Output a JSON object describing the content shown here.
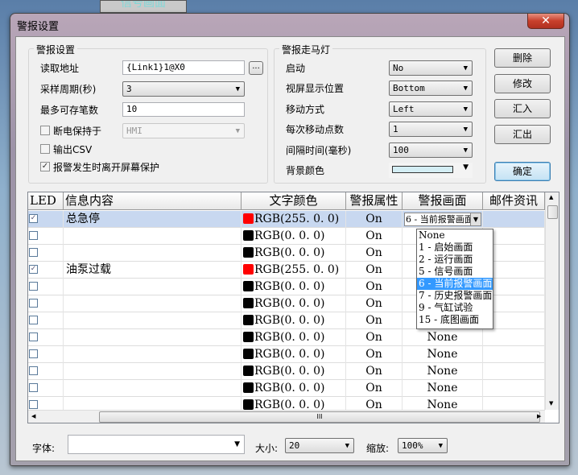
{
  "background": {
    "tab_label": "信号画面"
  },
  "window": {
    "title": "警报设置",
    "close_icon": "close-icon"
  },
  "alarm_settings": {
    "group_label": "警报设置",
    "read_address_label": "读取地址",
    "read_address_value": "{Link1}1@X0",
    "browse_label": "...",
    "sample_period_label": "采样周期(秒)",
    "sample_period_value": "3",
    "max_records_label": "最多可存笔数",
    "max_records_value": "10",
    "power_off_label": "断电保持于",
    "power_off_checked": false,
    "power_off_value": "HMI",
    "export_csv_label": "输出CSV",
    "export_csv_checked": false,
    "leave_screensaver_label": "报警发生时离开屏幕保护",
    "leave_screensaver_checked": true
  },
  "marquee": {
    "group_label": "警报走马灯",
    "enable_label": "启动",
    "enable_value": "No",
    "position_label": "视屏显示位置",
    "position_value": "Bottom",
    "move_label": "移动方式",
    "move_value": "Left",
    "step_label": "每次移动点数",
    "step_value": "1",
    "interval_label": "间隔时间(毫秒)",
    "interval_value": "100",
    "bgcolor_label": "背景颜色",
    "bgcolor_value": "#d4eef4"
  },
  "buttons": {
    "delete": "删除",
    "modify": "修改",
    "import": "汇入",
    "export": "汇出",
    "ok": "确定"
  },
  "table": {
    "columns": [
      "LED",
      "信息内容",
      "文字颜色",
      "警报属性",
      "警报画面",
      "邮件资讯"
    ],
    "rows": [
      {
        "led": true,
        "message": "总急停",
        "color": "#ff0000",
        "color_text": "RGB(255. 0. 0)",
        "attr": "On",
        "screen": "6 - 当前报警画面"
      },
      {
        "led": false,
        "message": "",
        "color": "#000000",
        "color_text": "RGB(0. 0. 0)",
        "attr": "On",
        "screen": "None"
      },
      {
        "led": false,
        "message": "",
        "color": "#000000",
        "color_text": "RGB(0. 0. 0)",
        "attr": "On",
        "screen": "None"
      },
      {
        "led": true,
        "message": "油泵过载",
        "color": "#ff0000",
        "color_text": "RGB(255. 0. 0)",
        "attr": "On",
        "screen": "None"
      },
      {
        "led": false,
        "message": "",
        "color": "#000000",
        "color_text": "RGB(0. 0. 0)",
        "attr": "On",
        "screen": "None"
      },
      {
        "led": false,
        "message": "",
        "color": "#000000",
        "color_text": "RGB(0. 0. 0)",
        "attr": "On",
        "screen": "None"
      },
      {
        "led": false,
        "message": "",
        "color": "#000000",
        "color_text": "RGB(0. 0. 0)",
        "attr": "On",
        "screen": "None"
      },
      {
        "led": false,
        "message": "",
        "color": "#000000",
        "color_text": "RGB(0. 0. 0)",
        "attr": "On",
        "screen": "None"
      },
      {
        "led": false,
        "message": "",
        "color": "#000000",
        "color_text": "RGB(0. 0. 0)",
        "attr": "On",
        "screen": "None"
      },
      {
        "led": false,
        "message": "",
        "color": "#000000",
        "color_text": "RGB(0. 0. 0)",
        "attr": "On",
        "screen": "None"
      },
      {
        "led": false,
        "message": "",
        "color": "#000000",
        "color_text": "RGB(0. 0. 0)",
        "attr": "On",
        "screen": "None"
      },
      {
        "led": false,
        "message": "",
        "color": "#000000",
        "color_text": "RGB(0. 0. 0)",
        "attr": "On",
        "screen": "None"
      }
    ],
    "dropdown_options": [
      "None",
      "1 - 启始画面",
      "2 - 运行画面",
      "5 - 信号画面",
      "6 - 当前报警画面",
      "7 - 历史报警画面",
      "9 - 气缸试验",
      "15 - 底图画面"
    ],
    "dropdown_selected": "6 - 当前报警画面",
    "scroll_grip": "III"
  },
  "footer": {
    "font_label": "字体:",
    "font_value": "",
    "size_label": "大小:",
    "size_value": "20",
    "zoom_label": "缩放:",
    "zoom_value": "100%"
  }
}
